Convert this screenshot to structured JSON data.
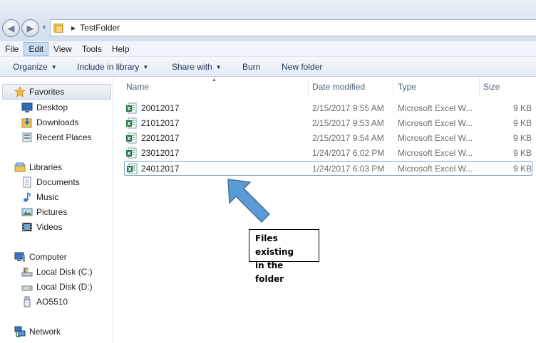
{
  "address": {
    "path": "TestFolder",
    "back_icon": "back-arrow-icon",
    "forward_icon": "forward-arrow-icon"
  },
  "menu": {
    "items": [
      "File",
      "Edit",
      "View",
      "Tools",
      "Help"
    ],
    "active": "Edit"
  },
  "toolbar": {
    "organize": "Organize",
    "include_in_library": "Include in library",
    "share_with": "Share with",
    "burn": "Burn",
    "new_folder": "New folder"
  },
  "nav": {
    "favorites": {
      "label": "Favorites",
      "items": [
        "Desktop",
        "Downloads",
        "Recent Places"
      ]
    },
    "libraries": {
      "label": "Libraries",
      "items": [
        "Documents",
        "Music",
        "Pictures",
        "Videos"
      ]
    },
    "computer": {
      "label": "Computer",
      "items": [
        "Local Disk (C:)",
        "Local Disk (D:)",
        "AO5510"
      ]
    },
    "network": {
      "label": "Network"
    }
  },
  "columns": {
    "name": "Name",
    "date_modified": "Date modified",
    "type": "Type",
    "size": "Size"
  },
  "files": [
    {
      "name": "20012017",
      "date": "2/15/2017 9:55 AM",
      "type": "Microsoft Excel W...",
      "size": "9 KB"
    },
    {
      "name": "21012017",
      "date": "2/15/2017 9:53 AM",
      "type": "Microsoft Excel W...",
      "size": "9 KB"
    },
    {
      "name": "22012017",
      "date": "2/15/2017 9:54 AM",
      "type": "Microsoft Excel W...",
      "size": "9 KB"
    },
    {
      "name": "23012017",
      "date": "1/24/2017 6:02 PM",
      "type": "Microsoft Excel W...",
      "size": "9 KB"
    },
    {
      "name": "24012017",
      "date": "1/24/2017 6:03 PM",
      "type": "Microsoft Excel W...",
      "size": "9 KB"
    }
  ],
  "annotation": {
    "line1": "Files existing",
    "line2": "in the folder"
  },
  "colors": {
    "accent_arrow": "#5b9bd5",
    "excel_green": "#217346",
    "menu_active": "#c8dcf3"
  }
}
